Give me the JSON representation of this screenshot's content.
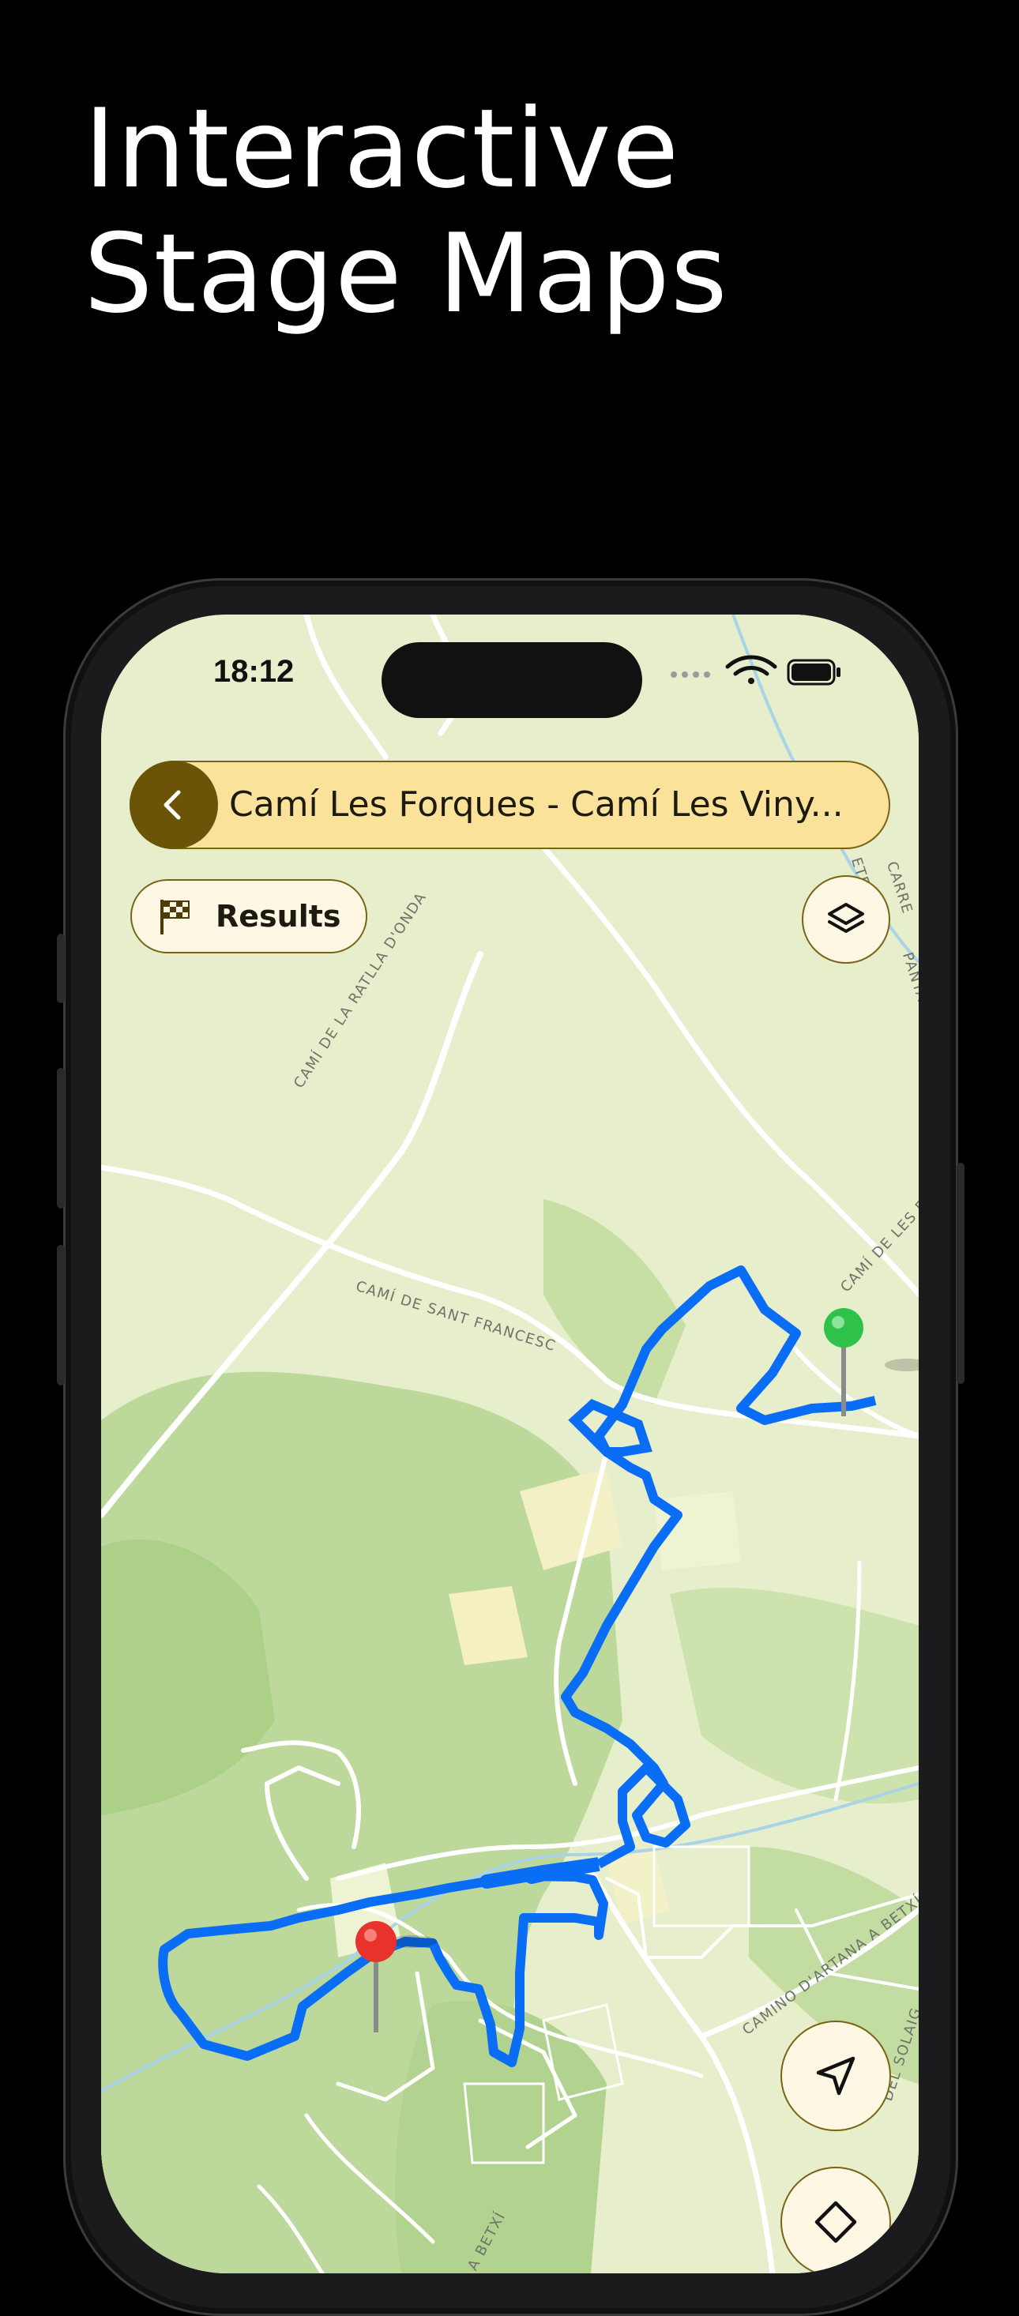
{
  "headline": {
    "line1": "Interactive",
    "line2": "Stage Maps"
  },
  "status_bar": {
    "time": "18:12",
    "icons": [
      "signal-dots-icon",
      "wifi-icon",
      "battery-icon"
    ]
  },
  "header": {
    "back_icon": "chevron-left-icon",
    "title": "Camí Les Forques - Camí Les Viny..."
  },
  "results_button": {
    "icon": "checkered-flag-icon",
    "label": "Results"
  },
  "map_controls": [
    "layers-icon",
    "navigation-arrow-icon"
  ],
  "road_labels": [
    "CAMÍ DE LA RATLLA D'ONDA",
    "CAMÍ DE SANT FRANCESC",
    "CAMÍ DE LES F",
    "CAMINO D'ARTANA A BETXÍ",
    "DEL SOLAIG",
    "A BETXÍ",
    "CARRE",
    "PANTA",
    "ETE"
  ],
  "markers": {
    "start_color": "#2fc24a",
    "finish_color": "#e8322c"
  },
  "colors": {
    "route": "#0a6df5",
    "accent": "#6b5407",
    "pill_fill": "#fbe29a",
    "map_base": "#e8efcc",
    "forest": "#bcd89a"
  }
}
